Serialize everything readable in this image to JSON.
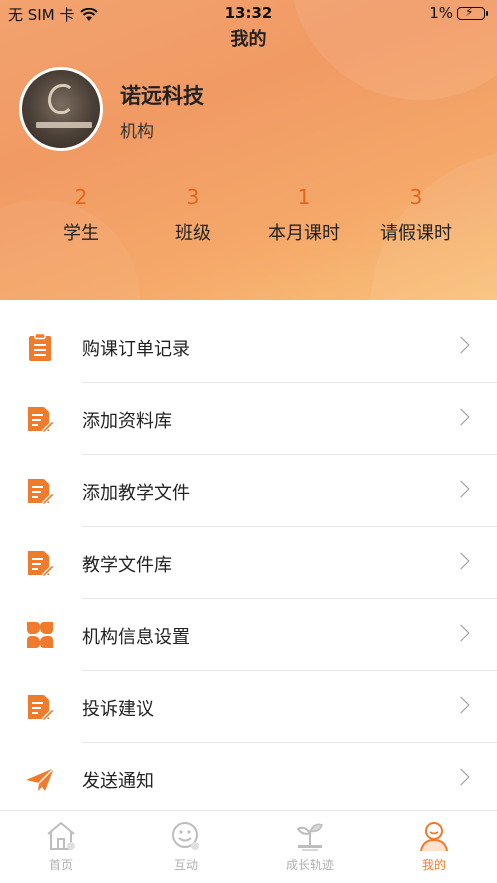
{
  "status_bar": {
    "carrier": "无 SIM 卡",
    "time": "13:32",
    "battery": "1%"
  },
  "nav": {
    "title": "我的"
  },
  "profile": {
    "name": "诺远科技",
    "type": "机构"
  },
  "stats": [
    {
      "value": "2",
      "label": "学生"
    },
    {
      "value": "3",
      "label": "班级"
    },
    {
      "value": "1",
      "label": "本月课时"
    },
    {
      "value": "3",
      "label": "请假课时"
    }
  ],
  "menu": [
    {
      "label": "购课订单记录",
      "icon": "clipboard-icon"
    },
    {
      "label": "添加资料库",
      "icon": "document-edit-icon"
    },
    {
      "label": "添加教学文件",
      "icon": "document-edit-icon"
    },
    {
      "label": "教学文件库",
      "icon": "document-edit-icon"
    },
    {
      "label": "机构信息设置",
      "icon": "four-petal-icon"
    },
    {
      "label": "投诉建议",
      "icon": "document-edit-icon"
    },
    {
      "label": "发送通知",
      "icon": "paper-plane-icon"
    }
  ],
  "tabbar": [
    {
      "label": "首页",
      "icon": "home-icon",
      "active": false
    },
    {
      "label": "互动",
      "icon": "chat-icon",
      "active": false
    },
    {
      "label": "成长轨迹",
      "icon": "growth-icon",
      "active": false
    },
    {
      "label": "我的",
      "icon": "user-icon",
      "active": true
    }
  ],
  "colors": {
    "accent": "#ef7a2d",
    "stat_number": "#e2651c",
    "icon_orange": "#f07b2c",
    "tab_inactive": "#b0b0b0"
  }
}
